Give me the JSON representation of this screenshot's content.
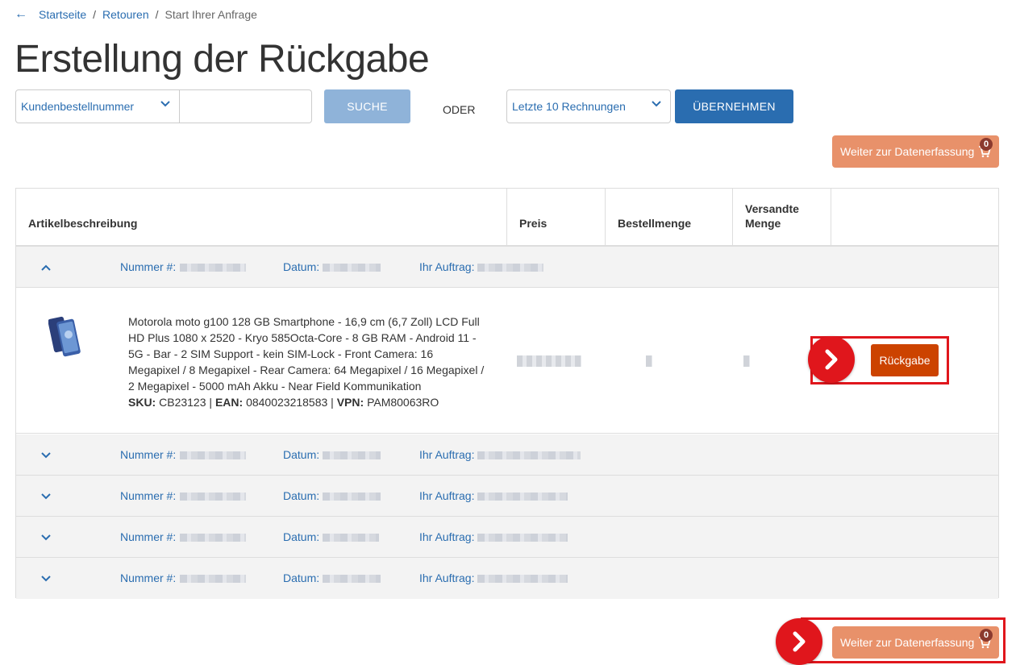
{
  "breadcrumb": {
    "back_icon": "arrow-left-icon",
    "items": [
      "Startseite",
      "Retouren"
    ],
    "current": "Start Ihrer Anfrage"
  },
  "page_title": "Erstellung der Rückgabe",
  "search": {
    "type_select": "Kundenbestellnummer",
    "input_value": "",
    "search_button": "SUCHE",
    "or_label": "ODER",
    "invoice_select": "Letzte 10 Rechnungen",
    "apply_button": "ÜBERNEHMEN"
  },
  "proceed": {
    "label": "Weiter zur Datenerfassung",
    "cart_count": "0",
    "icon": "shopping-cart-icon"
  },
  "table": {
    "headers": {
      "description": "Artikelbeschreibung",
      "price": "Preis",
      "ordered_qty": "Bestellmenge",
      "shipped_qty": "Versandte Menge"
    },
    "group_labels": {
      "number": "Nummer #:",
      "date": "Datum:",
      "order": "Ihr Auftrag:"
    },
    "expanded_item": {
      "description": "Motorola moto g100 128 GB Smartphone - 16,9 cm (6,7 Zoll) LCD Full HD Plus 1080 x 2520 - Kryo 585Octa-Core - 8 GB RAM - Android 11 - 5G - Bar - 2 SIM Support - kein SIM-Lock - Front Camera: 16 Megapixel / 8 Megapixel - Rear Camera: 64 Megapixel / 16 Megapixel / 2 Megapixel - 5000 mAh Akku - Near Field Kommunikation",
      "sku_label": "SKU:",
      "sku": "CB23123",
      "ean_label": "EAN:",
      "ean": "0840023218583",
      "vpn_label": "VPN:",
      "vpn": "PAM80063RO",
      "return_button": "Rückgabe"
    }
  },
  "colors": {
    "link_blue": "#2a6db0",
    "search_disabled": "#8fb3d9",
    "proceed_orange": "#e8916a",
    "return_orange": "#cc4300",
    "highlight_red": "#e0161c"
  }
}
